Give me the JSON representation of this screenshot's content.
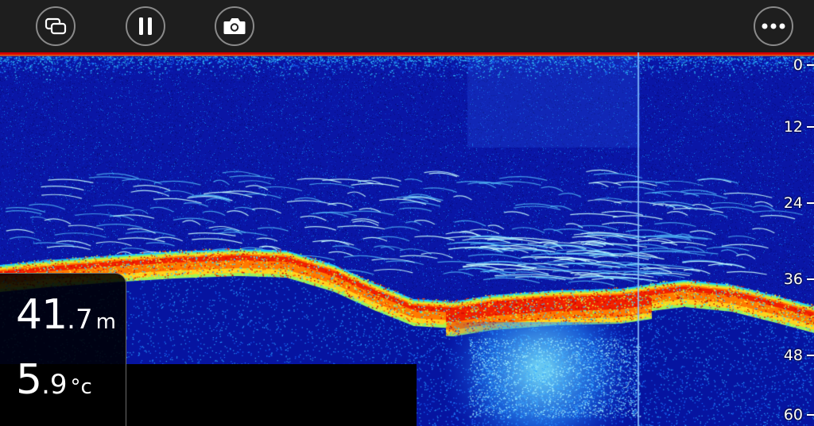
{
  "toolbar": {
    "buttons": [
      {
        "icon": "layers-icon",
        "action": "view-mode"
      },
      {
        "icon": "pause-icon",
        "action": "pause"
      },
      {
        "icon": "camera-icon",
        "action": "screenshot"
      },
      {
        "icon": "more-icon",
        "action": "menu"
      }
    ]
  },
  "readout": {
    "depth_int": "41",
    "depth_dec": ".7",
    "depth_unit": "m",
    "temp_int": "5",
    "temp_dec": ".9",
    "temp_unit": "°c"
  },
  "depth_scale": {
    "max": 60,
    "labels": [
      "0",
      "12",
      "24",
      "36",
      "48",
      "60"
    ]
  },
  "colors": {
    "toolbar_bg": "#1e1e1e",
    "button_ring": "#8a8a8a",
    "water": "#0a16a6",
    "surface": "#e00000",
    "bottom_hot": "#ff3b00",
    "text": "#ffffff"
  }
}
